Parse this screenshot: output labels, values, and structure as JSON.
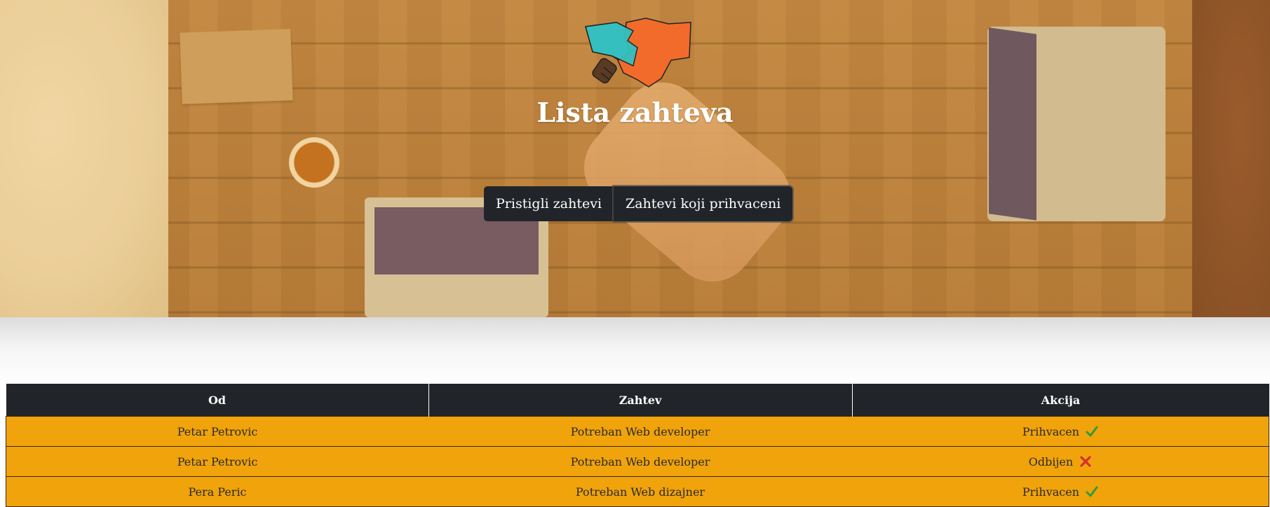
{
  "header": {
    "title": "Lista zahteva",
    "logo_icon": "handshake-icon"
  },
  "tabs": {
    "incoming_label": "Pristigli zahtevi",
    "accepted_label": "Zahtevi koji prihvaceni"
  },
  "table": {
    "columns": [
      "Od",
      "Zahtev",
      "Akcija"
    ],
    "rows": [
      {
        "from": "Petar Petrovic",
        "request": "Potreban Web developer",
        "action": "Prihvacen",
        "status_icon": "check-icon"
      },
      {
        "from": "Petar Petrovic",
        "request": "Potreban Web developer",
        "action": "Odbijen",
        "status_icon": "cross-icon"
      },
      {
        "from": "Pera Peric",
        "request": "Potreban Web dizajner",
        "action": "Prihvacen",
        "status_icon": "check-icon"
      }
    ]
  },
  "colors": {
    "header_bg": "#212529",
    "row_bg": "#f0a30a",
    "check_green": "#2e9c3a",
    "cross_red": "#d32f2f",
    "logo_teal": "#35bfbf",
    "logo_orange": "#f26b2b"
  }
}
